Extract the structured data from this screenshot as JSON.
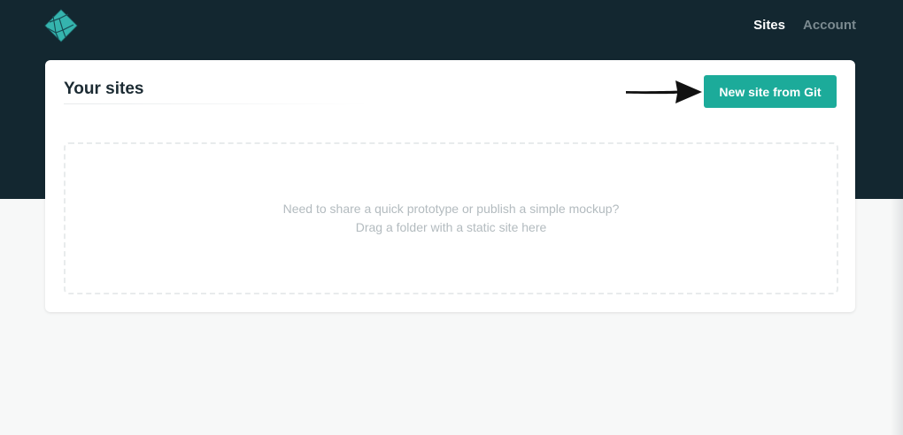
{
  "header": {
    "logo_icon": "netlify-logo-icon",
    "nav": [
      {
        "label": "Sites",
        "active": true
      },
      {
        "label": "Account",
        "active": false
      }
    ],
    "background_color": "#132730"
  },
  "main": {
    "title": "Your sites",
    "new_site_button": {
      "label": "New site from Git",
      "color": "#1cab9a"
    },
    "annotation_icon": "arrow-right-icon",
    "dropzone": {
      "line1": "Need to share a quick prototype or publish a simple mockup?",
      "line2": "Drag a folder with a static site here"
    }
  }
}
